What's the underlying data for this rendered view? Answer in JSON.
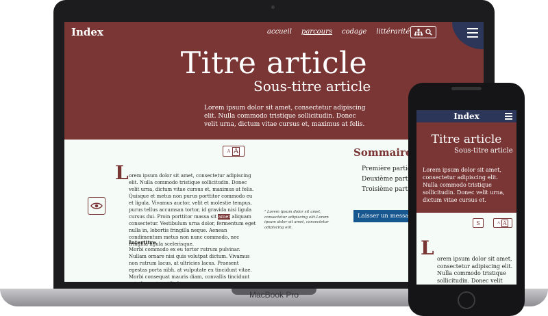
{
  "laptop": {
    "brand": "MacBook Pro",
    "site": {
      "logo": "Index",
      "nav": [
        "accueil",
        "parcours",
        "codage",
        "littérarité"
      ],
      "nav_active": "parcours",
      "title": "Titre article",
      "subtitle": "Sous-titre article",
      "intro": "Lorem ipsum dolor sit amet, consectetur adipiscing elit. Nulla commodo tristique sollicitudin. Donec velit urna, dictum vitae cursus et, maximus at felis.",
      "font_size_button": {
        "small": "A",
        "large": "A"
      },
      "dropcap": "L",
      "body_before_highlight": "orem ipsum dolor sit amet, consectetur adipiscing elit. Nulla commodo tristique sollicitudin. Donec velit urna, dictum vitae cursus et, maximus at felis. Quisque et metus non purus porttitor commodo eu et ligula. Vivamus auctor, velit et molestie tempus, purus tellus accumsan tortor, id gravida nisi ligula cursus dui. Proin porttitor massa sit",
      "body_highlight": "amet",
      "body_after_highlight": "aliquam consectetur. Vestibulum urna dolor, fermentum eget nulla in, lobortis fringilla neque. Aenean condimentum metus non nunc commodo, nec fringilla ligula scelerisque.",
      "intertitle": "Intertitre",
      "body2": "Morbi commodo ex eu tortor rutrum pulvinar. Nullam ornare nisi quis volutpat dictum. Vivamus non rutrum lacus, at ultricies lacus. Praesent egestas porta nibh, at vulputate ex tincidunt vitae. Morbi consequat mauris diam, convallis tincidunt ante laoreet vestibulum.",
      "footnote": "² Lorem ipsum dolor sit amet, consectetur adipiscing elit.Lorem ipsum dolor sit amet, consectetur adipiscing elit.",
      "summary_title": "Sommaire",
      "summary_items": [
        "Première partie de l'a",
        "Deuxième partie de l'",
        "Troisième partie de l'"
      ],
      "message_button": "Laisser un message sur la"
    }
  },
  "phone": {
    "logo": "Index",
    "title": "Titre article",
    "subtitle": "Sous-titre article",
    "intro": "Lorem ipsum dolor sit amet, consectetur adipiscing elit. Nulla commodo tristique sollicitudin. Donec velit urna, dictum vitae cursus et.",
    "s_button": "S",
    "a_button": {
      "small": "A",
      "large": "A"
    },
    "dropcap": "L",
    "body": "orem ipsum dolor sit amet, consectetur adipiscing elit. Nulla commodo tristique sollicitudin. Donec velit urna, dictum vitae cursus et, maximus at felis. Quisque et"
  },
  "colors": {
    "accent": "#7a3535",
    "navy": "#2b3659",
    "page_bg": "#f5fcf7",
    "button_blue": "#17578f"
  }
}
